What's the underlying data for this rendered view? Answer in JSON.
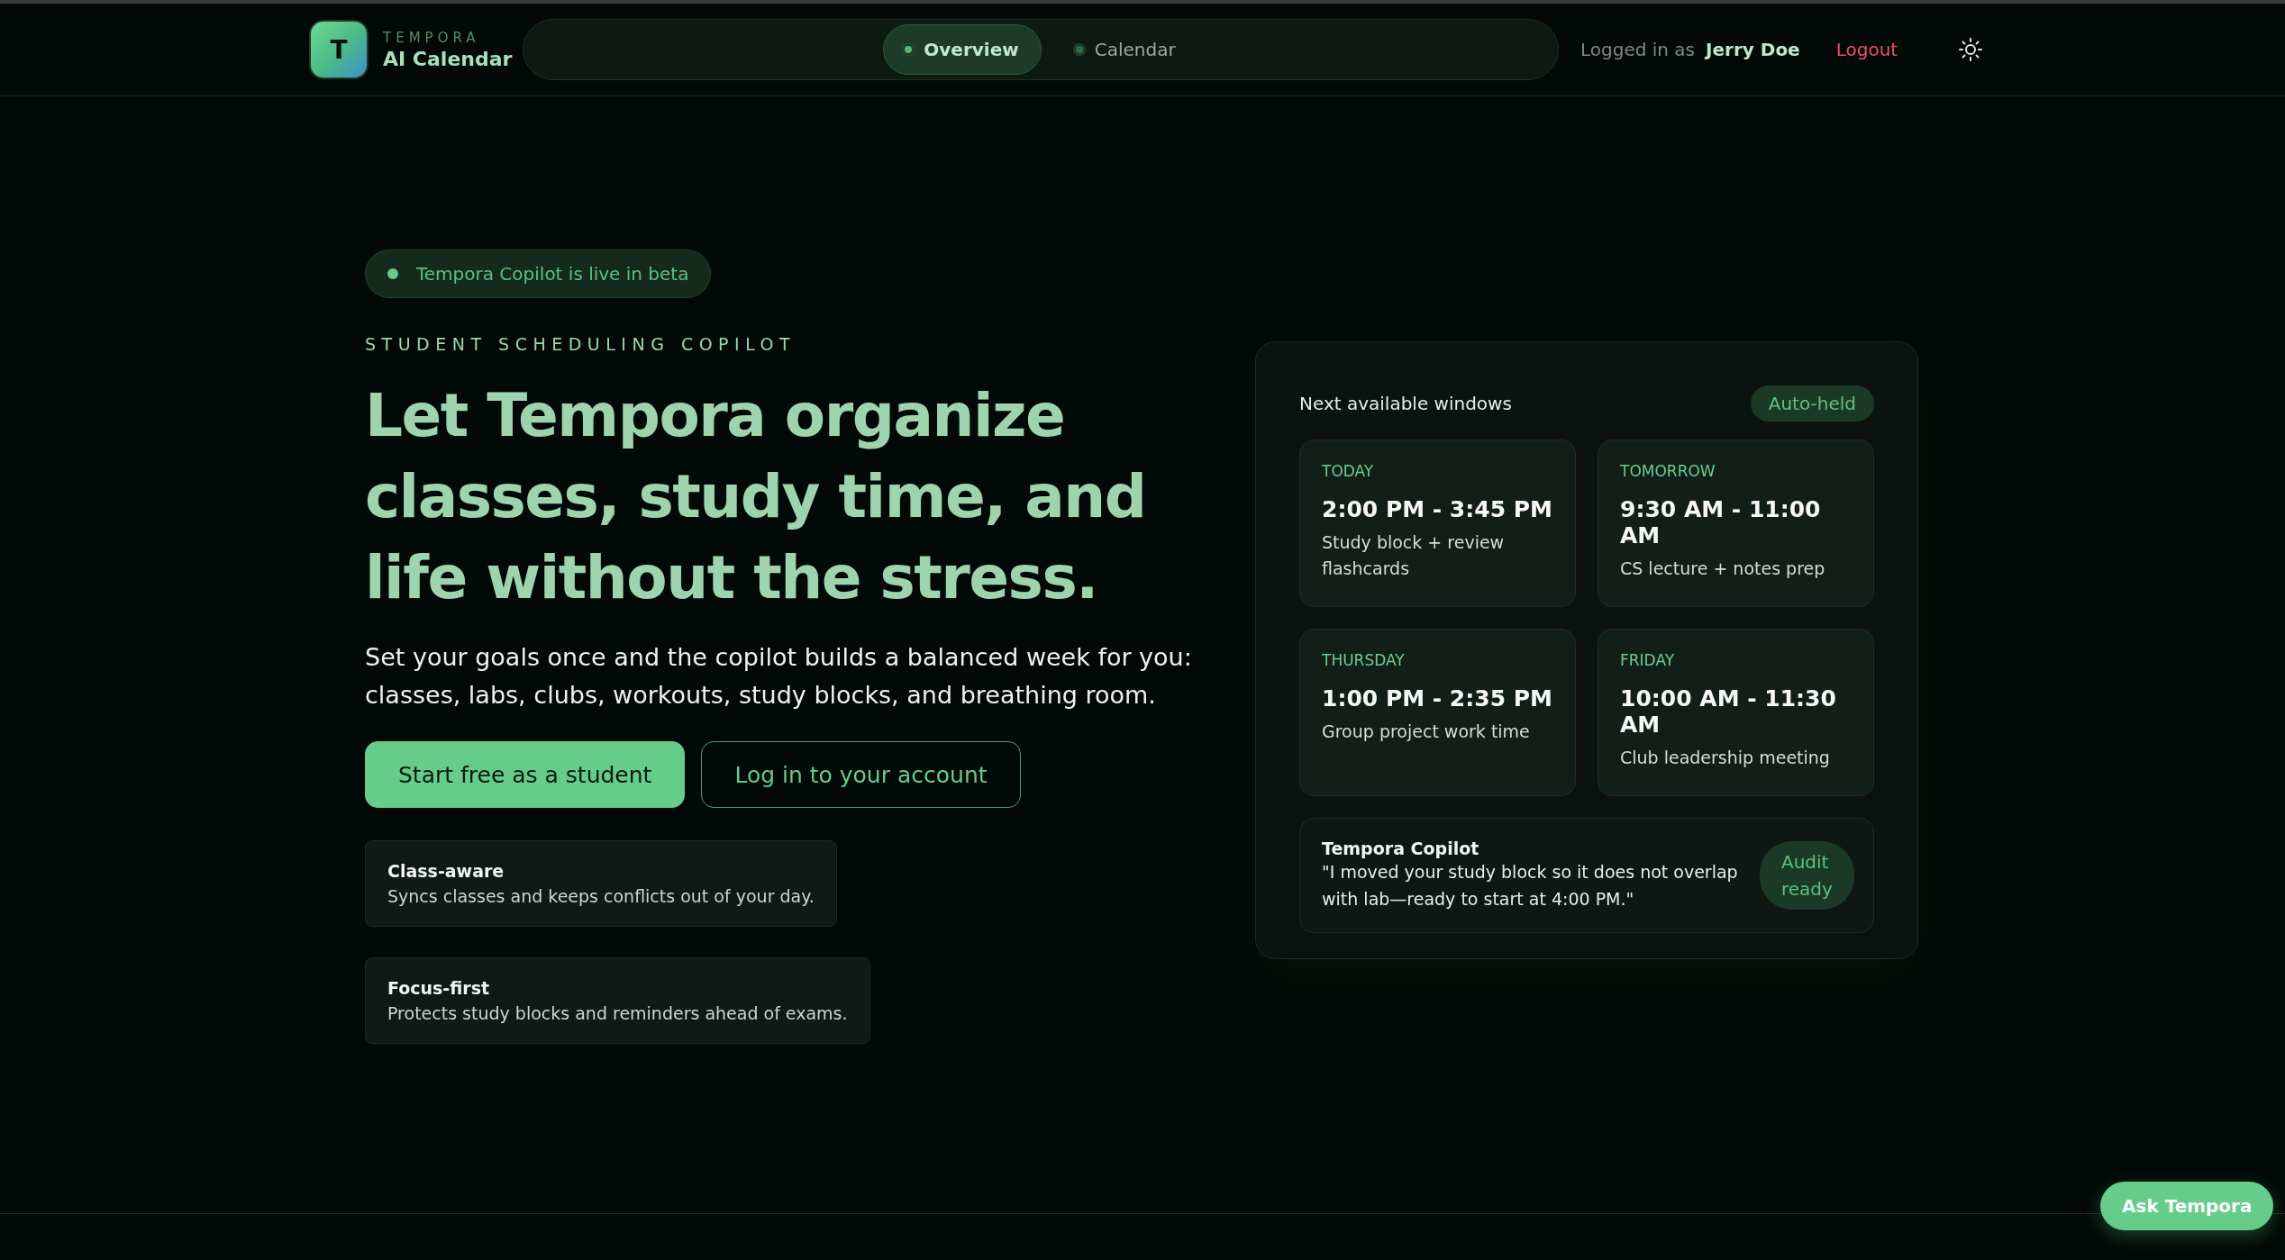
{
  "brand": {
    "logo_letter": "T",
    "name": "TEMPORA",
    "product": "AI Calendar"
  },
  "nav": {
    "tabs": [
      {
        "label": "Overview",
        "selected": true
      },
      {
        "label": "Calendar",
        "selected": false
      }
    ]
  },
  "account": {
    "prefix": "Logged in as",
    "user": "Jerry Doe",
    "logout": "Logout"
  },
  "hero": {
    "badge": "Tempora Copilot is live in beta",
    "eyebrow": "STUDENT SCHEDULING COPILOT",
    "heading": "Let Tempora organize classes, study time, and life without the stress.",
    "description": "Set your goals once and the copilot builds a balanced week for you: classes, labs, clubs, workouts, study blocks, and breathing room.",
    "buttons": [
      {
        "label": "Start free as a student",
        "kind": "primary"
      },
      {
        "label": "Log in to your account",
        "kind": "outline"
      }
    ],
    "features": [
      {
        "title": "Class-aware",
        "text": "Syncs classes and keeps conflicts out of your day."
      },
      {
        "title": "Focus-first",
        "text": "Protects study blocks and reminders ahead of exams."
      }
    ]
  },
  "panel": {
    "title": "Next available windows",
    "tag": "Auto-held",
    "slots": [
      {
        "day": "TODAY",
        "time": "2:00 PM - 3:45 PM",
        "note": "Study block + review flashcards"
      },
      {
        "day": "TOMORROW",
        "time": "9:30 AM - 11:00 AM",
        "note": "CS lecture + notes prep"
      },
      {
        "day": "THURSDAY",
        "time": "1:00 PM - 2:35 PM",
        "note": "Group project work time"
      },
      {
        "day": "FRIDAY",
        "time": "10:00 AM - 11:30 AM",
        "note": "Club leadership meeting"
      }
    ],
    "copilot": {
      "title": "Tempora Copilot",
      "message": "\"I moved your study block so it does not overlap with lab—ready to start at 4:00 PM.\"",
      "status": "Audit ready"
    }
  },
  "ask_button": "Ask Tempora"
}
